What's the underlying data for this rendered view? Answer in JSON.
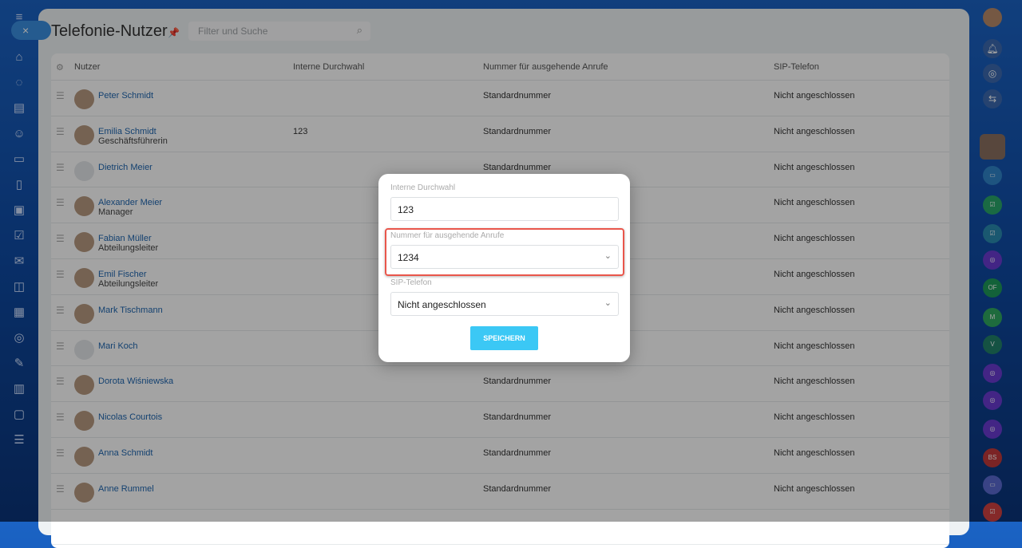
{
  "page": {
    "title": "Telefonie-Nutzer",
    "search_placeholder": "Filter und Suche",
    "close_label": "×"
  },
  "table": {
    "headers": [
      "Nutzer",
      "Interne Durchwahl",
      "Nummer für ausgehende Anrufe",
      "SIP-Telefon"
    ],
    "rows": [
      {
        "name": "Peter Schmidt",
        "position": "",
        "ext": "",
        "number": "Standardnummer",
        "sip": "Nicht angeschlossen"
      },
      {
        "name": "Emilia Schmidt",
        "position": "Geschäftsführerin",
        "ext": "123",
        "number": "Standardnummer",
        "sip": "Nicht angeschlossen"
      },
      {
        "name": "Dietrich Meier",
        "position": "",
        "ext": "",
        "number": "Standardnummer",
        "sip": "Nicht angeschlossen"
      },
      {
        "name": "Alexander Meier",
        "position": "Manager",
        "ext": "",
        "number": "",
        "sip": "Nicht angeschlossen"
      },
      {
        "name": "Fabian Müller",
        "position": "Abteilungsleiter",
        "ext": "",
        "number": "",
        "sip": "Nicht angeschlossen"
      },
      {
        "name": "Emil Fischer",
        "position": "Abteilungsleiter",
        "ext": "",
        "number": "",
        "sip": "Nicht angeschlossen"
      },
      {
        "name": "Mark Tischmann",
        "position": "",
        "ext": "",
        "number": "",
        "sip": "Nicht angeschlossen"
      },
      {
        "name": "Mari Koch",
        "position": "",
        "ext": "",
        "number": "",
        "sip": "Nicht angeschlossen"
      },
      {
        "name": "Dorota Wiśniewska",
        "position": "",
        "ext": "",
        "number": "Standardnummer",
        "sip": "Nicht angeschlossen"
      },
      {
        "name": "Nicolas Courtois",
        "position": "",
        "ext": "",
        "number": "Standardnummer",
        "sip": "Nicht angeschlossen"
      },
      {
        "name": "Anna Schmidt",
        "position": "",
        "ext": "",
        "number": "Standardnummer",
        "sip": "Nicht angeschlossen"
      },
      {
        "name": "Anne Rummel",
        "position": "",
        "ext": "",
        "number": "Standardnummer",
        "sip": "Nicht angeschlossen"
      }
    ]
  },
  "modal": {
    "ext_label": "Interne Durchwahl",
    "ext_value": "123",
    "number_label": "Nummer für ausgehende Anrufe",
    "number_value": "1234",
    "sip_label": "SIP-Telefon",
    "sip_value": "Nicht angeschlossen",
    "save_label": "SPEICHERN"
  },
  "rightbar": {
    "badges": [
      "OF",
      "M",
      "V",
      "BS"
    ]
  }
}
